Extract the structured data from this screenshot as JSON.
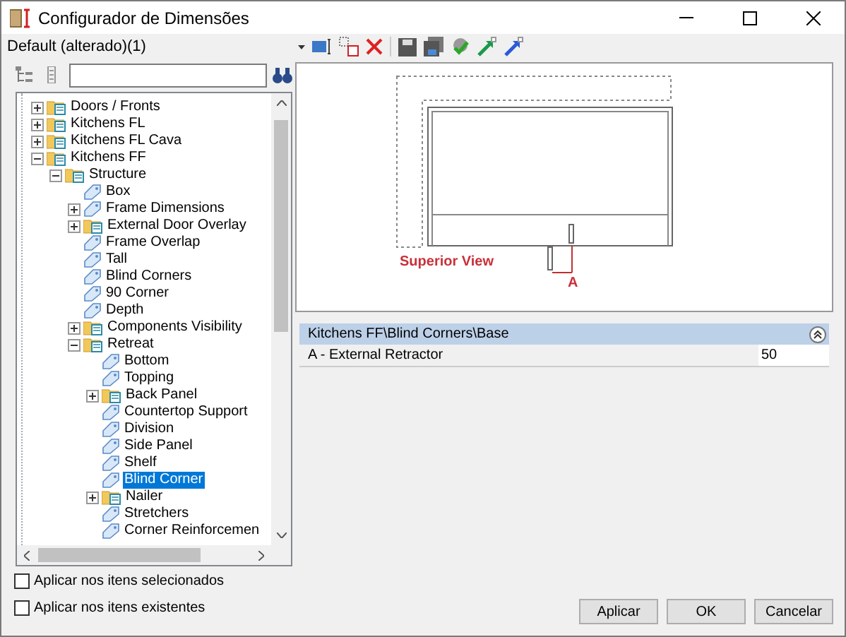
{
  "window": {
    "title": "Configurador de Dimensões"
  },
  "profile": "Default (alterado)(1)",
  "tree": [
    {
      "label": "Doors / Fronts",
      "kind": "folder",
      "expanded": false,
      "selected": false
    },
    {
      "label": "Kitchens FL",
      "kind": "folder",
      "expanded": false,
      "selected": false
    },
    {
      "label": "Kitchens FL Cava",
      "kind": "folder",
      "expanded": false,
      "selected": false
    },
    {
      "label": "Kitchens FF",
      "kind": "folder",
      "expanded": true,
      "selected": false,
      "children": [
        {
          "label": "Structure",
          "kind": "folder",
          "expanded": true,
          "selected": false,
          "children": [
            {
              "label": "Box",
              "kind": "item",
              "selected": false
            },
            {
              "label": "Frame Dimensions",
              "kind": "item",
              "expanded": false,
              "selected": false
            },
            {
              "label": "External Door Overlay",
              "kind": "folder",
              "expanded": false,
              "selected": false
            },
            {
              "label": "Frame Overlap",
              "kind": "item",
              "selected": false
            },
            {
              "label": "Tall",
              "kind": "item",
              "selected": false
            },
            {
              "label": "Blind Corners",
              "kind": "item",
              "selected": false
            },
            {
              "label": "90 Corner",
              "kind": "item",
              "selected": false
            },
            {
              "label": "Depth",
              "kind": "item",
              "selected": false
            },
            {
              "label": "Components Visibility",
              "kind": "folder",
              "expanded": false,
              "selected": false
            },
            {
              "label": "Retreat",
              "kind": "folder",
              "expanded": true,
              "selected": false,
              "children": [
                {
                  "label": "Bottom",
                  "kind": "item",
                  "selected": false
                },
                {
                  "label": "Topping",
                  "kind": "item",
                  "selected": false
                },
                {
                  "label": "Back Panel",
                  "kind": "folder",
                  "expanded": false,
                  "selected": false
                },
                {
                  "label": "Countertop Support",
                  "kind": "item",
                  "selected": false
                },
                {
                  "label": "Division",
                  "kind": "item",
                  "selected": false
                },
                {
                  "label": "Side Panel",
                  "kind": "item",
                  "selected": false
                },
                {
                  "label": "Shelf",
                  "kind": "item",
                  "selected": false
                },
                {
                  "label": "Blind Corner",
                  "kind": "item",
                  "selected": true
                },
                {
                  "label": "Nailer",
                  "kind": "folder",
                  "expanded": false,
                  "selected": false
                },
                {
                  "label": "Stretchers",
                  "kind": "item",
                  "selected": false
                },
                {
                  "label": "Corner Reinforcemen",
                  "kind": "item",
                  "selected": false
                }
              ]
            }
          ]
        }
      ]
    }
  ],
  "preview": {
    "view_label": "Superior View",
    "dimension_label": "A"
  },
  "properties": {
    "category": "Kitchens FF\\Blind Corners\\Base",
    "expanded": true,
    "rows": [
      {
        "name": "A - External Retractor",
        "value": "50"
      }
    ]
  },
  "options": [
    {
      "label": "Aplicar nos itens selecionados",
      "checked": false
    },
    {
      "label": "Aplicar nos itens existentes",
      "checked": false
    }
  ],
  "buttons": [
    "Aplicar",
    "OK",
    "Cancelar"
  ]
}
